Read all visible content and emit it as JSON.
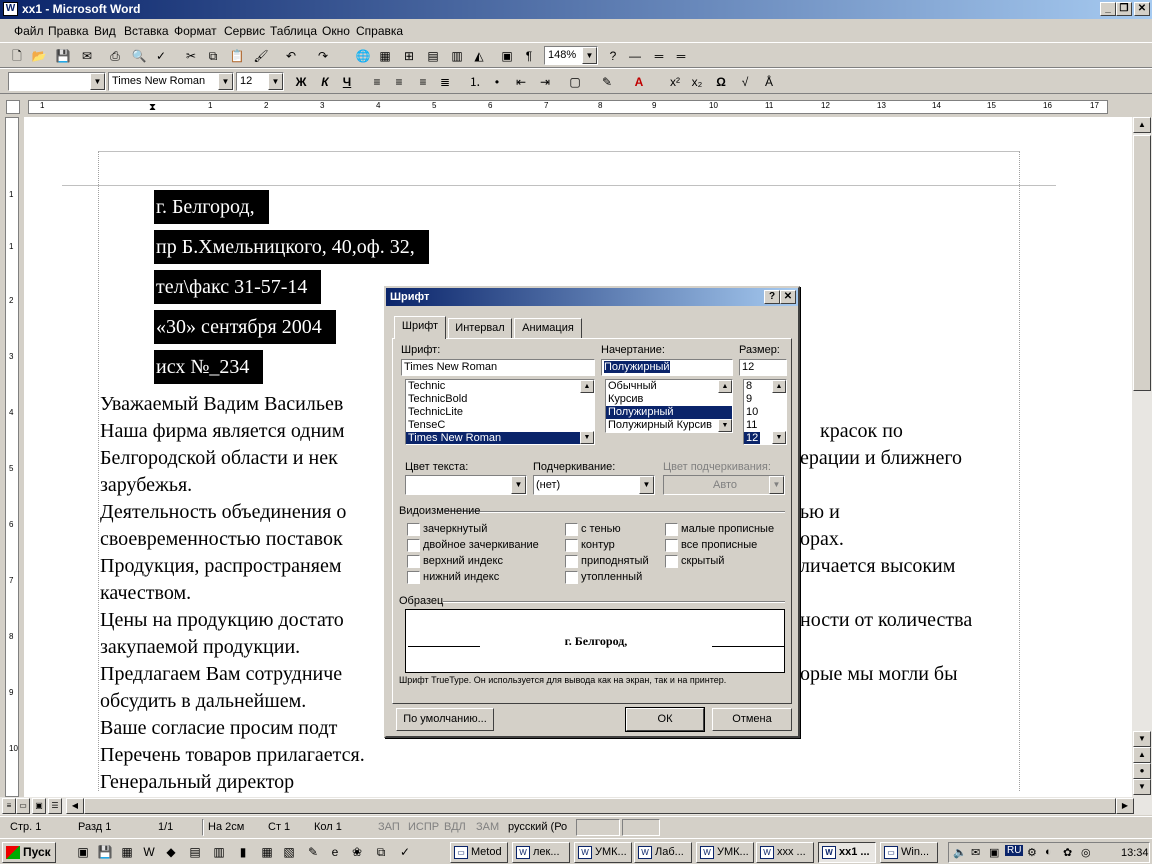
{
  "window": {
    "title": "xx1 - Microsoft Word"
  },
  "menu": [
    "Файл",
    "Правка",
    "Вид",
    "Вставка",
    "Формат",
    "Сервис",
    "Таблица",
    "Окно",
    "Справка"
  ],
  "formatting": {
    "style": "",
    "font": "Times New Roman",
    "size": "12",
    "zoom": "148%",
    "bold": "Ж",
    "italic": "К",
    "underline": "Ч"
  },
  "document": {
    "selected_lines": [
      "г. Белгород,",
      "пр Б.Хмельницкого, 40,оф. 32,",
      "тел\\факс 31-57-14",
      "«30»  сентября  2004",
      "исх №_234"
    ],
    "body_lines": [
      "Уважаемый Вадим Васильев",
      "Наша фирма является одним",
      "Белгородской области и нек",
      "зарубежья.",
      "Деятельность объединения о",
      "своевременностью поставок",
      "Продукция, распространяем",
      "качеством.",
      "Цены на продукцию достато",
      "закупаемой продукции.",
      "Предлагаем Вам сотрудниче",
      "обсудить в дальнейшем.",
      "Ваше согласие просим подт",
      "Перечень товаров прилагается.",
      "Генеральный директор"
    ],
    "right_fragments": [
      {
        "row": 1,
        "text": "красок по"
      },
      {
        "row": 2,
        "text": "ерации и ближнего"
      },
      {
        "row": 4,
        "text": "ью и"
      },
      {
        "row": 5,
        "text": "орах."
      },
      {
        "row": 6,
        "text": "личается высоким"
      },
      {
        "row": 8,
        "text": "ности от количества"
      },
      {
        "row": 10,
        "text": "орые мы могли бы"
      }
    ]
  },
  "dialog": {
    "title": "Шрифт",
    "tabs": [
      "Шрифт",
      "Интервал",
      "Анимация"
    ],
    "font_label": "Шрифт:",
    "font_value": "Times New Roman",
    "font_list": [
      "Technic",
      "TechnicBold",
      "TechnicLite",
      "TenseC",
      "Times New Roman"
    ],
    "style_label": "Начертание:",
    "style_value": "Полужирный",
    "style_list": [
      "Обычный",
      "Курсив",
      "Полужирный",
      "Полужирный Курсив"
    ],
    "size_label": "Размер:",
    "size_value": "12",
    "size_list": [
      "8",
      "9",
      "10",
      "11",
      "12"
    ],
    "color_label": "Цвет текста:",
    "color_value": "",
    "underline_label": "Подчеркивание:",
    "underline_value": "(нет)",
    "ucolor_label": "Цвет подчеркивания:",
    "ucolor_value": "Авто",
    "effects_label": "Видоизменение",
    "effects_col1": [
      "зачеркнутый",
      "двойное зачеркивание",
      "верхний индекс",
      "нижний индекс"
    ],
    "effects_col2": [
      "с тенью",
      "контур",
      "приподнятый",
      "утопленный"
    ],
    "effects_col3": [
      "малые прописные",
      "все прописные",
      "скрытый"
    ],
    "sample_label": "Образец",
    "sample_text": "г. Белгород,",
    "hint": "Шрифт TrueType. Он используется для вывода как на экран, так и на принтер.",
    "default_btn": "По умолчанию...",
    "ok_btn": "ОК",
    "cancel_btn": "Отмена"
  },
  "ruler_h": [
    "1",
    "1",
    "2",
    "3",
    "4",
    "5",
    "6",
    "7",
    "8",
    "9",
    "10",
    "11",
    "12",
    "13",
    "14",
    "15",
    "16",
    "17"
  ],
  "ruler_v": [
    "1",
    "1",
    "2",
    "3",
    "4",
    "5",
    "6",
    "7",
    "8",
    "9",
    "10"
  ],
  "status": {
    "page": "Стр. 1",
    "section": "Разд 1",
    "pages": "1/1",
    "at": "На 2см",
    "line": "Ст 1",
    "col": "Кол 1",
    "rec": "ЗАП",
    "trk": "ИСПР",
    "ext": "ВДЛ",
    "ovr": "ЗАМ",
    "lang": "русский (Ро"
  },
  "taskbar": {
    "start": "Пуск",
    "tasks": [
      "Metod",
      "лек...",
      "УМК...",
      "Лаб...",
      "УМК...",
      "ххх ...",
      "хх1 ...",
      "Win..."
    ],
    "clock": "13:34",
    "lang": "RU"
  }
}
